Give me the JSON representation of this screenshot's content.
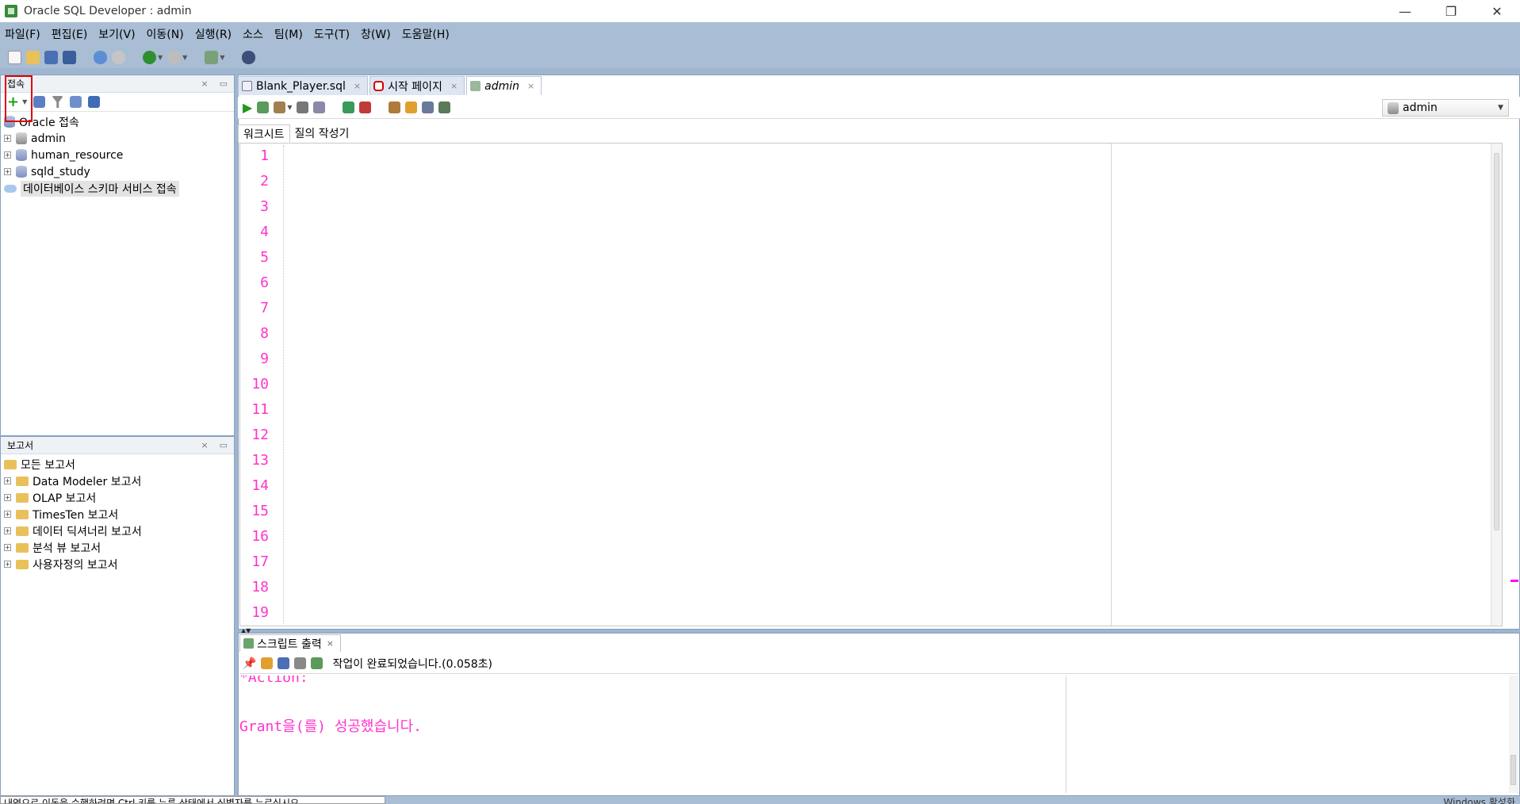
{
  "window": {
    "title": "Oracle SQL Developer : admin",
    "controls": [
      "—",
      "❐",
      "✕"
    ]
  },
  "menu": [
    "파일(F)",
    "편집(E)",
    "보기(V)",
    "이동(N)",
    "실행(R)",
    "소스",
    "팀(M)",
    "도구(T)",
    "창(W)",
    "도움말(H)"
  ],
  "connections": {
    "header": "접속",
    "root": "Oracle 접속",
    "items": [
      "admin",
      "human_resource",
      "sqld_study"
    ],
    "cloud": "데이터베이스 스키마 서비스 접속"
  },
  "reports": {
    "header": "보고서",
    "root": "모든 보고서",
    "items": [
      "Data Modeler 보고서",
      "OLAP 보고서",
      "TimesTen 보고서",
      "데이터 딕셔너리 보고서",
      "분석 뷰 보고서",
      "사용자정의 보고서"
    ]
  },
  "editor": {
    "tabs": [
      "Blank_Player.sql",
      "시작 페이지",
      "admin"
    ],
    "active_tab": "admin",
    "connection": "admin",
    "subtabs": [
      "워크시트",
      "질의 작성기"
    ],
    "line_numbers": [
      "1",
      "2",
      "3",
      "4",
      "5",
      "6",
      "7",
      "8",
      "9",
      "10",
      "11",
      "12",
      "13",
      "14",
      "15",
      "16",
      "17",
      "18",
      "19"
    ]
  },
  "output": {
    "tab": "스크립트 출력",
    "status": "작업이 완료되었습니다.(0.058초)",
    "line1": "*Action:",
    "line2": "Grant을(를) 성공했습니다."
  },
  "statusbar": {
    "left": "내역으로 이동을 수행하려면 Ctrl 키를 누른 상태에서 식별자를 누르십시오",
    "right": "Windows 활성화"
  },
  "colors": {
    "accent_red": "#e00000",
    "line_numbers": "#ff33cc",
    "frame": "#a9bdd4"
  }
}
